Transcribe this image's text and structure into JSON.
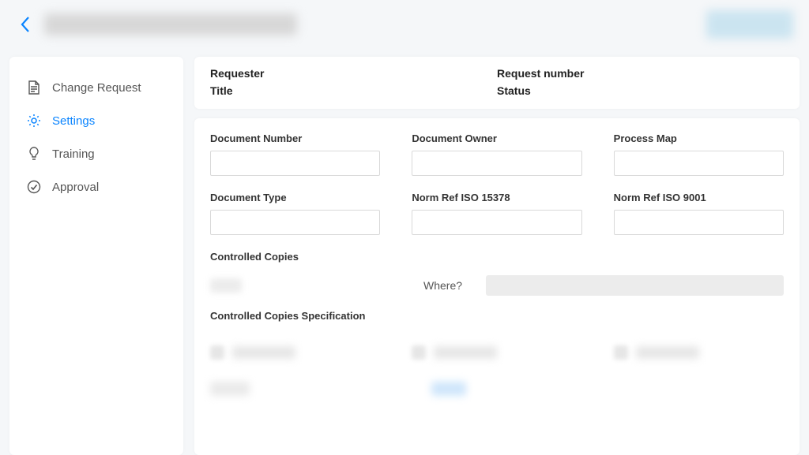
{
  "header": {
    "back_icon": "chevron-left"
  },
  "sidebar": {
    "items": [
      {
        "label": "Change Request",
        "icon": "document-icon",
        "active": false
      },
      {
        "label": "Settings",
        "icon": "gear-icon",
        "active": true
      },
      {
        "label": "Training",
        "icon": "bulb-icon",
        "active": false
      },
      {
        "label": "Approval",
        "icon": "check-circle-icon",
        "active": false
      }
    ]
  },
  "summary": {
    "requester_label": "Requester",
    "request_number_label": "Request number",
    "title_label": "Title",
    "status_label": "Status"
  },
  "form": {
    "document_number_label": "Document Number",
    "document_owner_label": "Document Owner",
    "process_map_label": "Process Map",
    "document_type_label": "Document Type",
    "norm_ref_15378_label": "Norm Ref ISO 15378",
    "norm_ref_9001_label": "Norm Ref ISO 9001",
    "controlled_copies_label": "Controlled Copies",
    "where_label": "Where?",
    "controlled_copies_spec_label": "Controlled Copies Specification"
  }
}
